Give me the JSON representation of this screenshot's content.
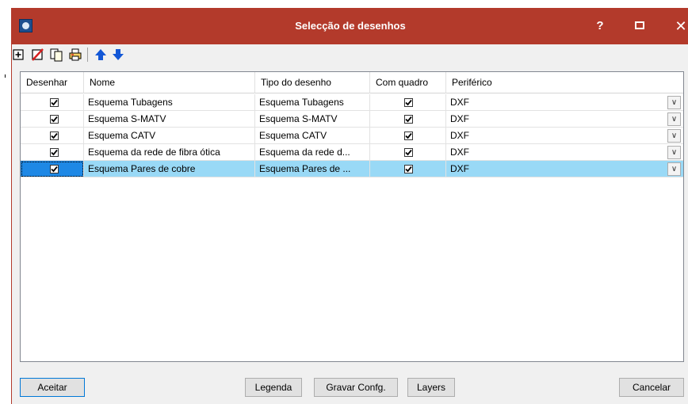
{
  "window": {
    "title": "Selecção de desenhos",
    "help_label": "?",
    "close_label": "✕"
  },
  "toolbar": {
    "icons": [
      "add-icon",
      "delete-icon",
      "copy-icon",
      "print-icon",
      "move-up-icon",
      "move-down-icon"
    ]
  },
  "grid": {
    "columns": [
      "Desenhar",
      "Nome",
      "Tipo do desenho",
      "Com quadro",
      "Periférico"
    ],
    "rows": [
      {
        "desenhar": true,
        "nome": "Esquema Tubagens",
        "tipo": "Esquema Tubagens",
        "com_quadro": true,
        "periferico": "DXF"
      },
      {
        "desenhar": true,
        "nome": "Esquema S-MATV",
        "tipo": "Esquema S-MATV",
        "com_quadro": true,
        "periferico": "DXF"
      },
      {
        "desenhar": true,
        "nome": "Esquema CATV",
        "tipo": "Esquema CATV",
        "com_quadro": true,
        "periferico": "DXF"
      },
      {
        "desenhar": true,
        "nome": "Esquema da rede de fibra ótica",
        "tipo": "Esquema da rede d...",
        "com_quadro": true,
        "periferico": "DXF"
      },
      {
        "desenhar": true,
        "nome": "Esquema Pares de cobre",
        "tipo": "Esquema Pares de ...",
        "com_quadro": true,
        "periferico": "DXF",
        "selected": true
      }
    ]
  },
  "buttons": {
    "accept": "Aceitar",
    "legend": "Legenda",
    "save_config": "Gravar Confg.",
    "layers": "Layers",
    "cancel": "Cancelar"
  },
  "colors": {
    "titlebar": "#b33a2b",
    "selected_row": "#99d9f6",
    "selected_cell": "#1e88e5"
  }
}
